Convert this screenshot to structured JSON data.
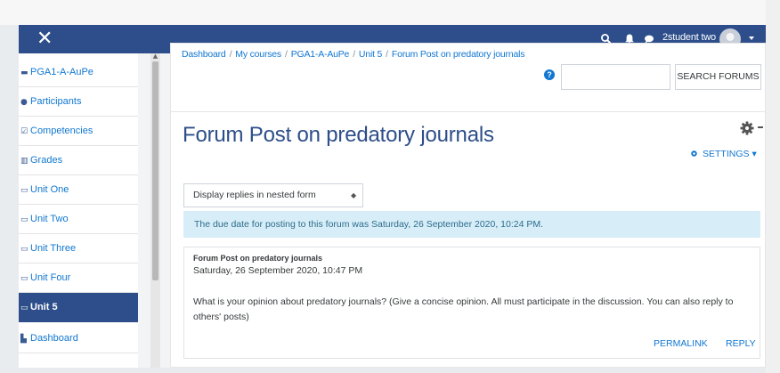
{
  "navbar": {
    "close_glyph": "✕",
    "user_name": "2student two",
    "icons": [
      "search-icon",
      "bell-icon",
      "chat-bubble-icon",
      "user-avatar",
      "caret-down-icon"
    ],
    "color": "#2d4e8a"
  },
  "sidebar": {
    "items": [
      {
        "label": "PGA1-A-AuPe",
        "icon": "course-icon",
        "glyph": "▬"
      },
      {
        "label": "Participants",
        "icon": "users-icon",
        "glyph": "●"
      },
      {
        "label": "Competencies",
        "icon": "competency-icon",
        "glyph": "☑"
      },
      {
        "label": "Grades",
        "icon": "grades-icon",
        "glyph": "▥"
      },
      {
        "label": "Unit One",
        "icon": "folder-icon",
        "glyph": "▭"
      },
      {
        "label": "Unit Two",
        "icon": "folder-icon",
        "glyph": "▭"
      },
      {
        "label": "Unit Three",
        "icon": "folder-icon",
        "glyph": "▭"
      },
      {
        "label": "Unit Four",
        "icon": "folder-icon",
        "glyph": "▭"
      },
      {
        "label": "Unit 5",
        "icon": "folder-icon",
        "glyph": "▭",
        "active": true
      },
      {
        "label": "Dashboard",
        "icon": "dashboard-icon",
        "glyph": "▙"
      }
    ],
    "active_color": "#2d4e8a"
  },
  "breadcrumb": [
    "Dashboard",
    "My courses",
    "PGA1-A-AuPe",
    "Unit 5",
    "Forum Post on predatory journals"
  ],
  "search": {
    "placeholder": "",
    "button_label": "SEARCH FORUMS",
    "help_glyph": "?"
  },
  "main": {
    "title": "Forum Post on predatory journals",
    "settings_label": "SETTINGS",
    "settings_caret": "▾",
    "display_mode": "Display replies in nested form",
    "select_arrows": "◆",
    "due_notice": "The due date for posting to this forum was Saturday, 26 September 2020, 10:24 PM."
  },
  "post": {
    "subject": "Forum Post on predatory journals",
    "date": "Saturday, 26 September 2020, 10:47 PM",
    "body": "What is your opinion about predatory journals?  (Give a concise opinion. All must participate in the discussion. You can also reply to others' posts)",
    "permalink_label": "PERMALINK",
    "reply_label": "REPLY"
  },
  "colors": {
    "link": "#1177d1",
    "alert_bg": "#d7eef8",
    "alert_text": "#2e6c8c"
  }
}
